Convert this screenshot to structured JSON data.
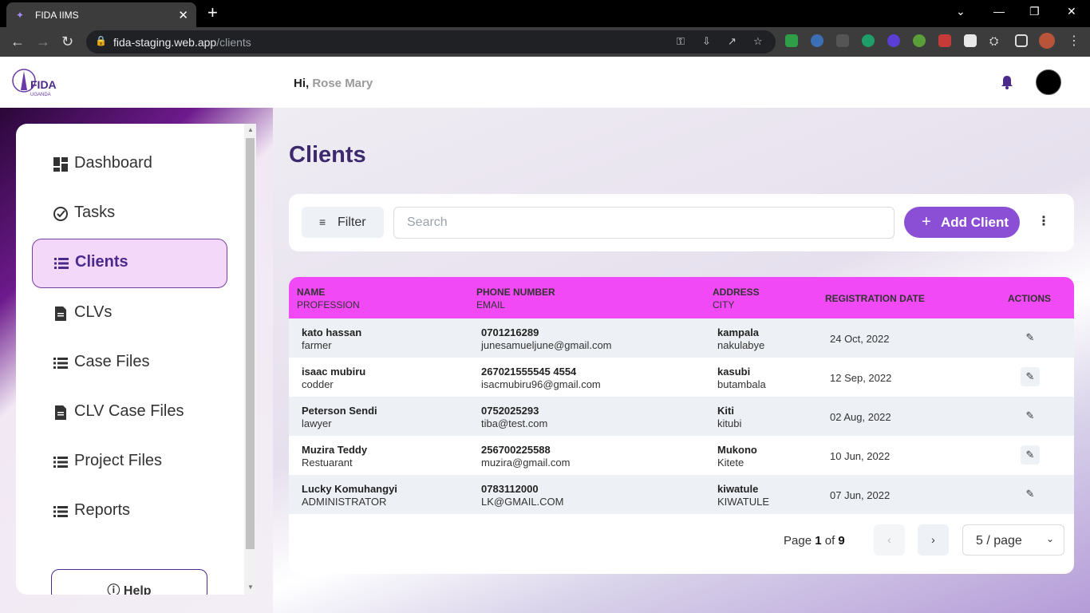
{
  "browser": {
    "tab_title": "FIDA IIMS",
    "url_host": "fida-staging.web.app",
    "url_path": "/clients"
  },
  "header": {
    "greeting": "Hi,",
    "user_name": "Rose Mary"
  },
  "sidebar": {
    "items": [
      {
        "label": "Dashboard",
        "icon": "dashboard-icon"
      },
      {
        "label": "Tasks",
        "icon": "check-circle-icon"
      },
      {
        "label": "Clients",
        "icon": "list-icon",
        "active": true
      },
      {
        "label": "CLVs",
        "icon": "document-icon"
      },
      {
        "label": "Case Files",
        "icon": "list-icon"
      },
      {
        "label": "CLV Case Files",
        "icon": "document-icon"
      },
      {
        "label": "Project Files",
        "icon": "list-icon"
      },
      {
        "label": "Reports",
        "icon": "list-icon"
      }
    ],
    "help_label": "Help"
  },
  "main": {
    "title": "Clients",
    "filter_label": "Filter",
    "search_placeholder": "Search",
    "add_label": "Add Client"
  },
  "table": {
    "headers": {
      "name": "NAME",
      "profession": "PROFESSION",
      "phone": "PHONE NUMBER",
      "email": "EMAIL",
      "address": "ADDRESS",
      "city": "CITY",
      "regdate": "REGISTRATION DATE",
      "actions": "ACTIONS"
    },
    "rows": [
      {
        "name": "kato hassan",
        "profession": "farmer",
        "phone": "0701216289",
        "email": "junesamueljune@gmail.com",
        "address": "kampala",
        "city": "nakulabye",
        "date": "24 Oct, 2022"
      },
      {
        "name": "isaac mubiru",
        "profession": "codder",
        "phone": "267021555545 4554",
        "email": "isacmubiru96@gmail.com",
        "address": "kasubi",
        "city": "butambala",
        "date": "12 Sep, 2022"
      },
      {
        "name": "Peterson Sendi",
        "profession": "lawyer",
        "phone": "0752025293",
        "email": "tiba@test.com",
        "address": "Kiti",
        "city": "kitubi",
        "date": "02 Aug, 2022"
      },
      {
        "name": "Muzira Teddy",
        "profession": "Restuarant",
        "phone": "256700225588",
        "email": "muzira@gmail.com",
        "address": "Mukono",
        "city": "Kitete",
        "date": "10 Jun, 2022"
      },
      {
        "name": "Lucky Komuhangyi",
        "profession": "ADMINISTRATOR",
        "phone": "0783112000",
        "email": "LK@GMAIL.COM",
        "address": "kiwatule",
        "city": "KIWATULE",
        "date": "07 Jun, 2022"
      }
    ]
  },
  "pagination": {
    "page_word": "Page",
    "current": "1",
    "of_word": "of",
    "total": "9",
    "per_page": "5 / page"
  },
  "colors": {
    "accent": "#8b4fd6",
    "header_row": "#f149f5",
    "title": "#3d2a6e"
  }
}
